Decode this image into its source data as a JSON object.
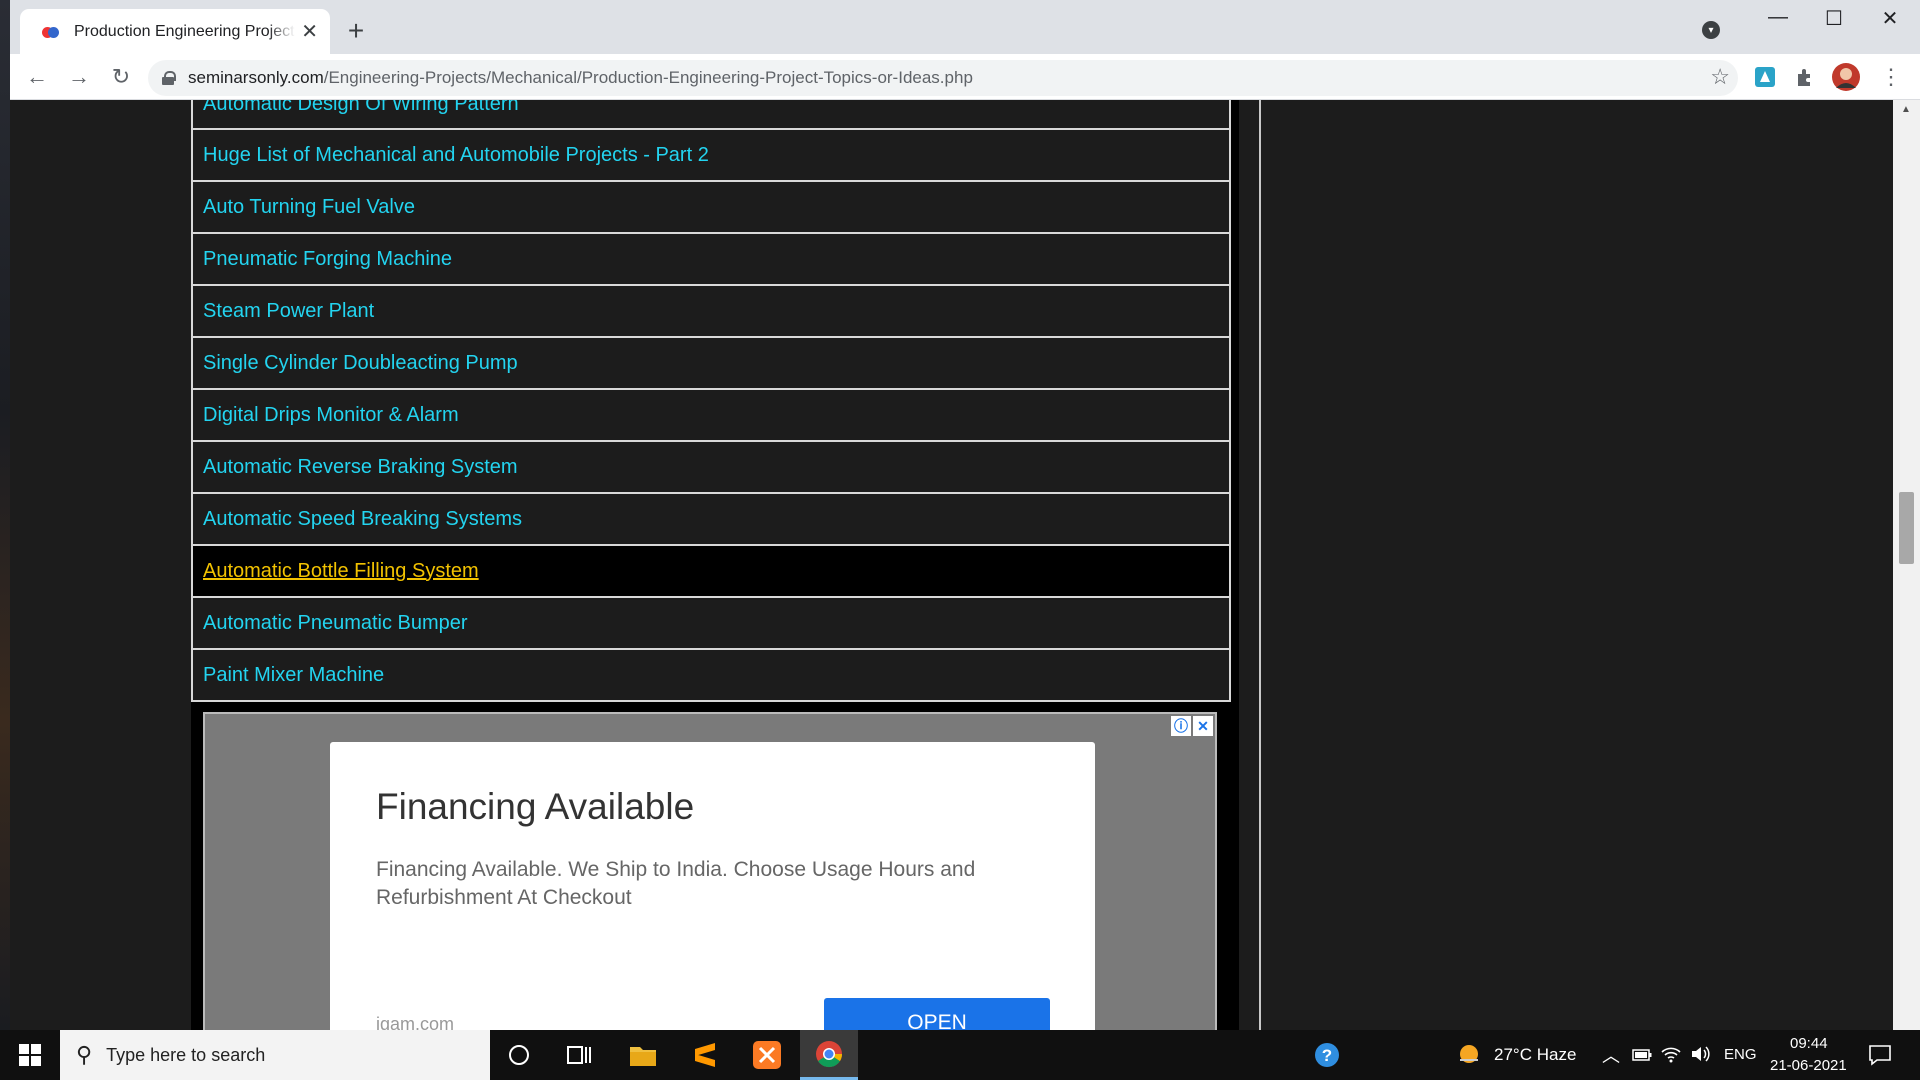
{
  "browser": {
    "tab_title": "Production Engineering Project Topics or Ideas",
    "new_tab": "+",
    "url_domain": "seminarsonly.com",
    "url_path": "/Engineering-Projects/Mechanical/Production-Engineering-Project-Topics-or-Ideas.php",
    "window_controls": {
      "minimize": "—",
      "maximize": "☐",
      "close": "✕"
    },
    "nav": {
      "back": "←",
      "forward": "→",
      "reload": "↻"
    },
    "star": "☆",
    "menu": "⋮"
  },
  "list": {
    "items": [
      {
        "label": "Automatic Design Of Wiring Pattern"
      },
      {
        "label": "Huge List of Mechanical and Automobile Projects - Part 2"
      },
      {
        "label": "Auto Turning Fuel Valve"
      },
      {
        "label": "Pneumatic Forging Machine"
      },
      {
        "label": "Steam Power Plant"
      },
      {
        "label": "Single Cylinder Doubleacting Pump"
      },
      {
        "label": "Digital Drips Monitor & Alarm"
      },
      {
        "label": "Automatic Reverse Braking System"
      },
      {
        "label": "Automatic Speed Breaking Systems"
      },
      {
        "label": "Automatic Bottle Filling System"
      },
      {
        "label": "Automatic Pneumatic Bumper"
      },
      {
        "label": "Paint Mixer Machine"
      }
    ],
    "active_index": 9
  },
  "ad": {
    "title": "Financing Available",
    "description": "Financing Available. We Ship to India. Choose Usage Hours and Refurbishment At Checkout",
    "domain": "igam.com",
    "cta": "OPEN",
    "info_badge": "ⓘ",
    "close_badge": "✕"
  },
  "taskbar": {
    "search_placeholder": "Type here to search",
    "weather": "27°C  Haze",
    "language": "ENG",
    "time": "09:44",
    "date": "21-06-2021"
  },
  "colors": {
    "link": "#23d4f0",
    "link_active": "#f2c200",
    "ad_button": "#1a73e8"
  }
}
